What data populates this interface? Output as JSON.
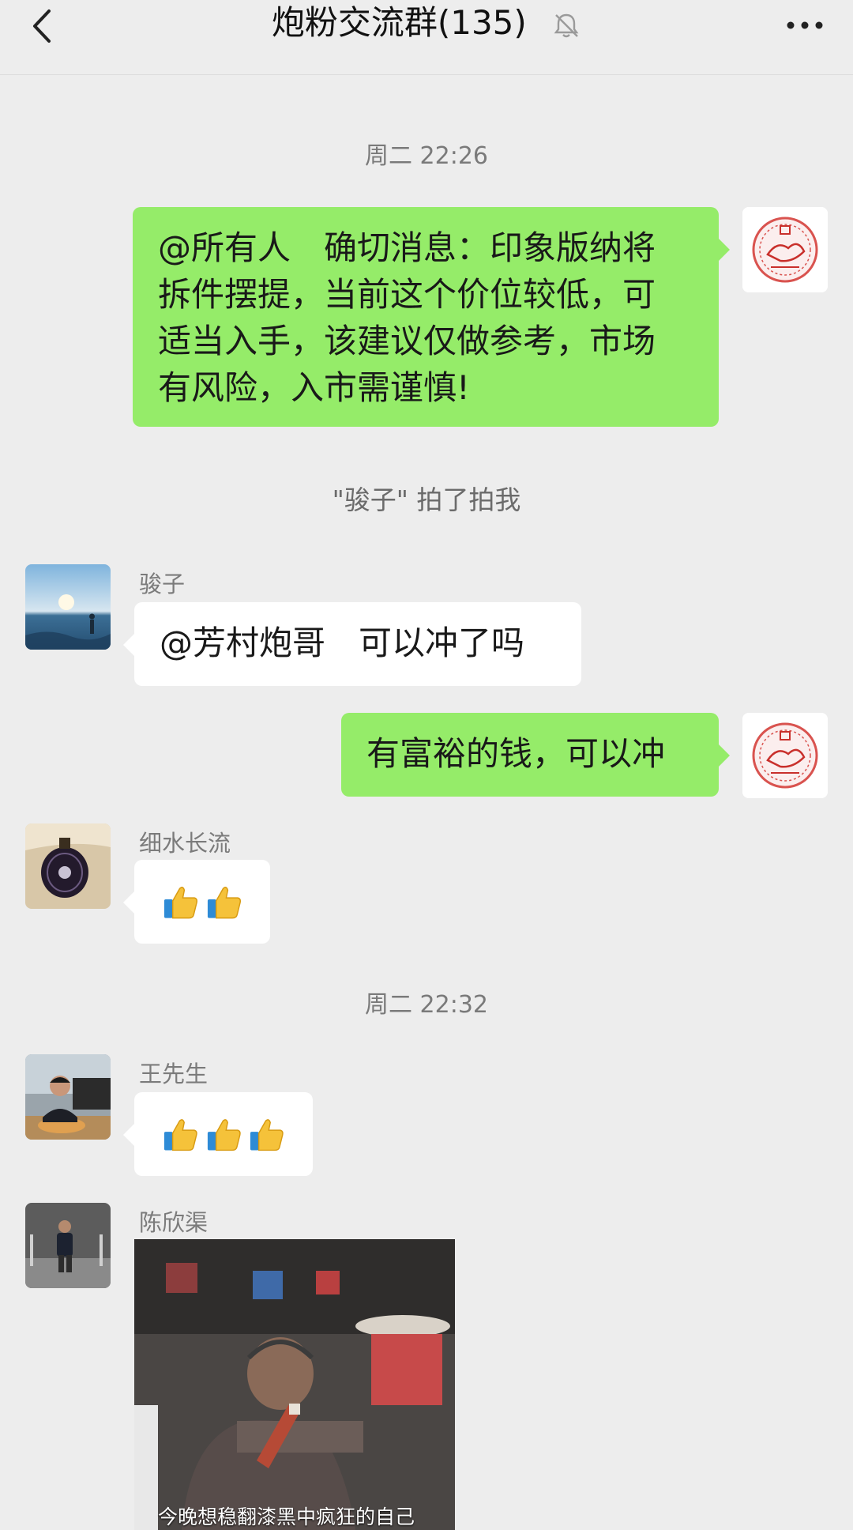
{
  "header": {
    "title": "炮粉交流群(135)"
  },
  "timestamps": [
    "周二 22:26",
    "周二 22:32"
  ],
  "system_notice": "\"骏子\" 拍了拍我",
  "messages": {
    "m1": {
      "lines": [
        "@所有人　确切消息：印象版纳将",
        "拆件摆提，当前这个价位较低，可",
        "适当入手，该建议仅做参考，市场",
        "有风险，入市需谨慎!"
      ]
    },
    "m2": {
      "sender": "骏子",
      "text": "@芳村炮哥　可以冲了吗"
    },
    "m3": {
      "text": "有富裕的钱，可以冲"
    },
    "m4": {
      "sender": "细水长流",
      "emoji_count": 2
    },
    "m5": {
      "sender": "王先生",
      "emoji_count": 3
    },
    "m6": {
      "sender": "陈欣渠",
      "caption": "今晚想稳翻漆黑中疯狂的自己"
    }
  },
  "icons": [
    "back-arrow",
    "mute-bell",
    "more-dots",
    "thumbs-up"
  ],
  "colors": {
    "background": "#ededed",
    "self_bubble": "#95ec69",
    "other_bubble": "#ffffff"
  }
}
